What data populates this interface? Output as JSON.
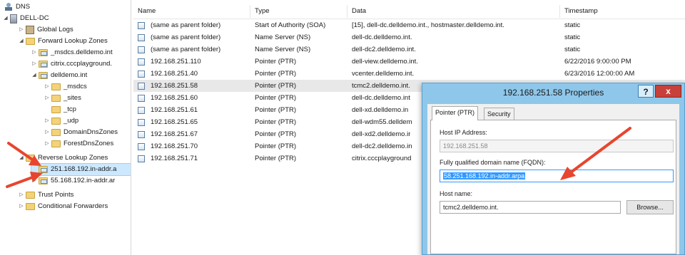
{
  "tree": {
    "root": "DNS",
    "server": "DELL-DC",
    "global_logs": "Global Logs",
    "forward_zones": "Forward Lookup Zones",
    "msdcs_zone": "_msdcs.delldemo.int",
    "citrix_zone": "citrix.cccplayground.",
    "delldemo_zone": "delldemo.int",
    "msdcs": "_msdcs",
    "sites": "_sites",
    "tcp": "_tcp",
    "udp": "_udp",
    "domain_dns": "DomainDnsZones",
    "forest_dns": "ForestDnsZones",
    "reverse_zones": "Reverse Lookup Zones",
    "rev1": "251.168.192.in-addr.a",
    "rev2": "55.168.192.in-addr.ar",
    "trust_points": "Trust Points",
    "cond_forwarders": "Conditional Forwarders"
  },
  "columns": {
    "name": "Name",
    "type": "Type",
    "data": "Data",
    "timestamp": "Timestamp"
  },
  "records": [
    {
      "name": "(same as parent folder)",
      "type": "Start of Authority (SOA)",
      "data": "[15], dell-dc.delldemo.int., hostmaster.delldemo.int.",
      "timestamp": "static"
    },
    {
      "name": "(same as parent folder)",
      "type": "Name Server (NS)",
      "data": "dell-dc.delldemo.int.",
      "timestamp": "static"
    },
    {
      "name": "(same as parent folder)",
      "type": "Name Server (NS)",
      "data": "dell-dc2.delldemo.int.",
      "timestamp": "static"
    },
    {
      "name": "192.168.251.110",
      "type": "Pointer (PTR)",
      "data": "dell-view.delldemo.int.",
      "timestamp": "6/22/2016 9:00:00 PM"
    },
    {
      "name": "192.168.251.40",
      "type": "Pointer (PTR)",
      "data": "vcenter.delldemo.int.",
      "timestamp": "6/23/2016 12:00:00 AM"
    },
    {
      "name": "192.168.251.58",
      "type": "Pointer (PTR)",
      "data": "tcmc2.delldemo.int.",
      "timestamp": ""
    },
    {
      "name": "192.168.251.60",
      "type": "Pointer (PTR)",
      "data": "dell-dc.delldemo.int",
      "timestamp": ""
    },
    {
      "name": "192.168.251.61",
      "type": "Pointer (PTR)",
      "data": "dell-xd.delldemo.in",
      "timestamp": ""
    },
    {
      "name": "192.168.251.65",
      "type": "Pointer (PTR)",
      "data": "dell-wdm55.delldem",
      "timestamp": ""
    },
    {
      "name": "192.168.251.67",
      "type": "Pointer (PTR)",
      "data": "dell-xd2.delldemo.ir",
      "timestamp": ""
    },
    {
      "name": "192.168.251.70",
      "type": "Pointer (PTR)",
      "data": "dell-dc2.delldemo.in",
      "timestamp": ""
    },
    {
      "name": "192.168.251.71",
      "type": "Pointer (PTR)",
      "data": "citrix.cccplayground",
      "timestamp": ""
    }
  ],
  "dialog": {
    "title": "192.168.251.58 Properties",
    "help": "?",
    "close": "x",
    "tab_ptr": "Pointer (PTR)",
    "tab_security": "Security",
    "host_ip_label": "Host IP Address:",
    "host_ip_value": "192.168.251.58",
    "fqdn_label": "Fully qualified domain name (FQDN):",
    "fqdn_value": "58.251.168.192.in-addr.arpa",
    "hostname_label": "Host name:",
    "hostname_value": "tcmc2.delldemo.int.",
    "browse": "Browse..."
  },
  "colors": {
    "selection": "#cce8ff",
    "dialog_frame": "#8ec7ea",
    "close": "#c7403a",
    "arrow": "#e8452f"
  },
  "icons": [
    "dns-icon",
    "server-icon",
    "log-icon",
    "folder-icon",
    "zone-icon",
    "record-icon",
    "expand-arrow-icon",
    "collapse-arrow-icon"
  ]
}
